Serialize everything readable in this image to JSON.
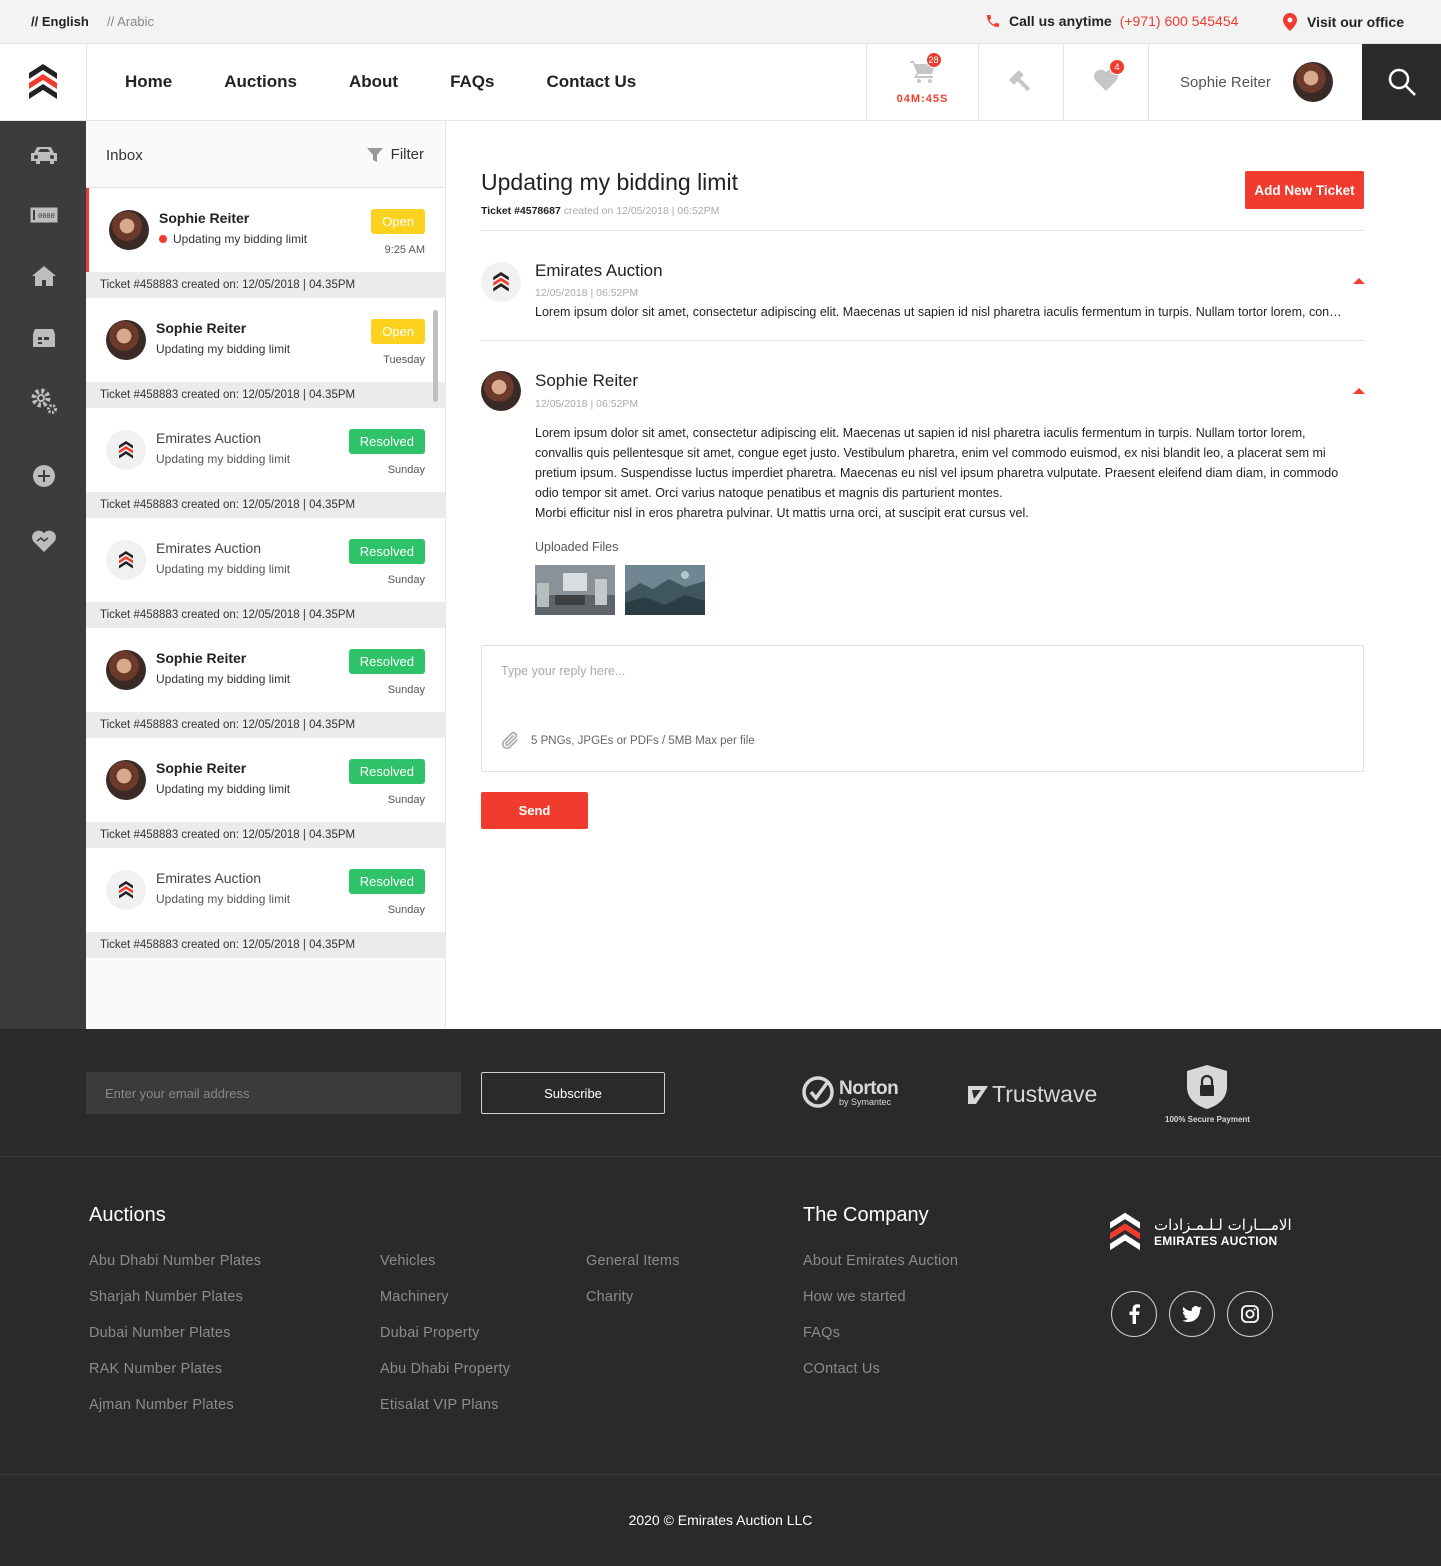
{
  "topbar": {
    "lang_english": "// English",
    "lang_arabic": "// Arabic",
    "call_label": "Call us anytime",
    "call_number": "(+971) 600 545454",
    "visit_label": "Visit our office"
  },
  "nav": {
    "items": [
      "Home",
      "Auctions",
      "About",
      "FAQs",
      "Contact Us"
    ]
  },
  "header": {
    "cart_count": "28",
    "timer": "04M:45S",
    "favorites_count": "4",
    "user_name": "Sophie Reiter"
  },
  "inbox": {
    "title": "Inbox",
    "filter_label": "Filter",
    "tickets": [
      {
        "name": "Sophie Reiter",
        "subject": "Updating my bidding limit",
        "status": "Open",
        "time": "9:25 AM",
        "meta": "Ticket #458883 created on: 12/05/2018  |  04.35PM",
        "sender": "user",
        "unread": true
      },
      {
        "name": "Sophie Reiter",
        "subject": "Updating my bidding limit",
        "status": "Open",
        "time": "Tuesday",
        "meta": "Ticket #458883 created on: 12/05/2018  |  04.35PM",
        "sender": "user"
      },
      {
        "name": "Emirates Auction",
        "subject": "Updating my bidding limit",
        "status": "Resolved",
        "time": "Sunday",
        "meta": "Ticket #458883 created on: 12/05/2018  |  04.35PM",
        "sender": "ea"
      },
      {
        "name": "Emirates Auction",
        "subject": "Updating my bidding limit",
        "status": "Resolved",
        "time": "Sunday",
        "meta": "Ticket #458883 created on: 12/05/2018  |  04.35PM",
        "sender": "ea"
      },
      {
        "name": "Sophie Reiter",
        "subject": "Updating my bidding limit",
        "status": "Resolved",
        "time": "Sunday",
        "meta": "Ticket #458883 created on: 12/05/2018  |  04.35PM",
        "sender": "user"
      },
      {
        "name": "Sophie Reiter",
        "subject": "Updating my bidding limit",
        "status": "Resolved",
        "time": "Sunday",
        "meta": "Ticket #458883 created on: 12/05/2018  |  04.35PM",
        "sender": "user"
      },
      {
        "name": "Emirates Auction",
        "subject": "Updating my bidding limit",
        "status": "Resolved",
        "time": "Sunday",
        "meta": "Ticket #458883 created on: 12/05/2018  |  04.35PM",
        "sender": "ea"
      }
    ]
  },
  "ticket": {
    "title": "Updating my bidding limit",
    "number": "Ticket #4578687",
    "created": "created on 12/05/2018  |  06:52PM",
    "add_button": "Add New Ticket",
    "messages": [
      {
        "sender": "Emirates Auction",
        "date": "12/05/2018  |  06:52PM",
        "body": "Lorem ipsum dolor sit amet, consectetur adipiscing elit. Maecenas ut sapien id nisl pharetra iaculis fermentum in turpis. Nullam tortor lorem, convallis quis pellentesque sit amet, congue eget justo."
      },
      {
        "sender": "Sophie Reiter",
        "date": "12/05/2018  |  06:52PM",
        "body": "Lorem ipsum dolor sit amet, consectetur adipiscing elit. Maecenas ut sapien id nisl pharetra iaculis fermentum in turpis. Nullam tortor lorem, convallis quis pellentesque sit amet, congue eget justo. Vestibulum pharetra, enim vel commodo euismod, ex nisi blandit leo, a placerat sem mi pretium ipsum. Suspendisse luctus imperdiet pharetra. Maecenas eu nisl vel ipsum pharetra vulputate. Praesent eleifend diam diam, in commodo odio tempor sit amet. Orci varius natoque penatibus et magnis dis parturient montes.",
        "body2": "Morbi efficitur nisl in eros pharetra pulvinar. Ut mattis urna orci, at suscipit erat cursus vel.",
        "files_label": "Uploaded Files"
      }
    ],
    "reply_placeholder": "Type your reply here...",
    "attach_hint": "5 PNGs, JPGEs or PDFs / 5MB Max per file",
    "send_button": "Send"
  },
  "footer": {
    "email_placeholder": "Enter your email address",
    "subscribe_button": "Subscribe",
    "norton": "Norton",
    "norton_sub": "by Symantec",
    "trustwave": "Trustwave",
    "secure_payment": "100% Secure Payment",
    "auctions_title": "Auctions",
    "auctions_col1": [
      "Abu Dhabi Number Plates",
      "Sharjah Number Plates",
      "Dubai Number Plates",
      "RAK Number Plates",
      "Ajman Number Plates"
    ],
    "auctions_col2": [
      "Vehicles",
      "Machinery",
      "Dubai Property",
      "Abu Dhabi Property",
      "Etisalat VIP Plans"
    ],
    "auctions_col3": [
      "General Items",
      "Charity"
    ],
    "company_title": "The Company",
    "company_links": [
      "About Emirates Auction",
      "How we started",
      "FAQs",
      "COntact Us"
    ],
    "brand_arabic": "الامـــارات لـلـمـزادات",
    "brand_english": "EMIRATES AUCTION",
    "copyright": "2020 © Emirates Auction LLC"
  },
  "colors": {
    "accent": "#f03c2f",
    "open": "#fcd21f",
    "resolved": "#2ec269",
    "sidebar": "#3c3c3c",
    "footer": "#2a2a2a"
  }
}
